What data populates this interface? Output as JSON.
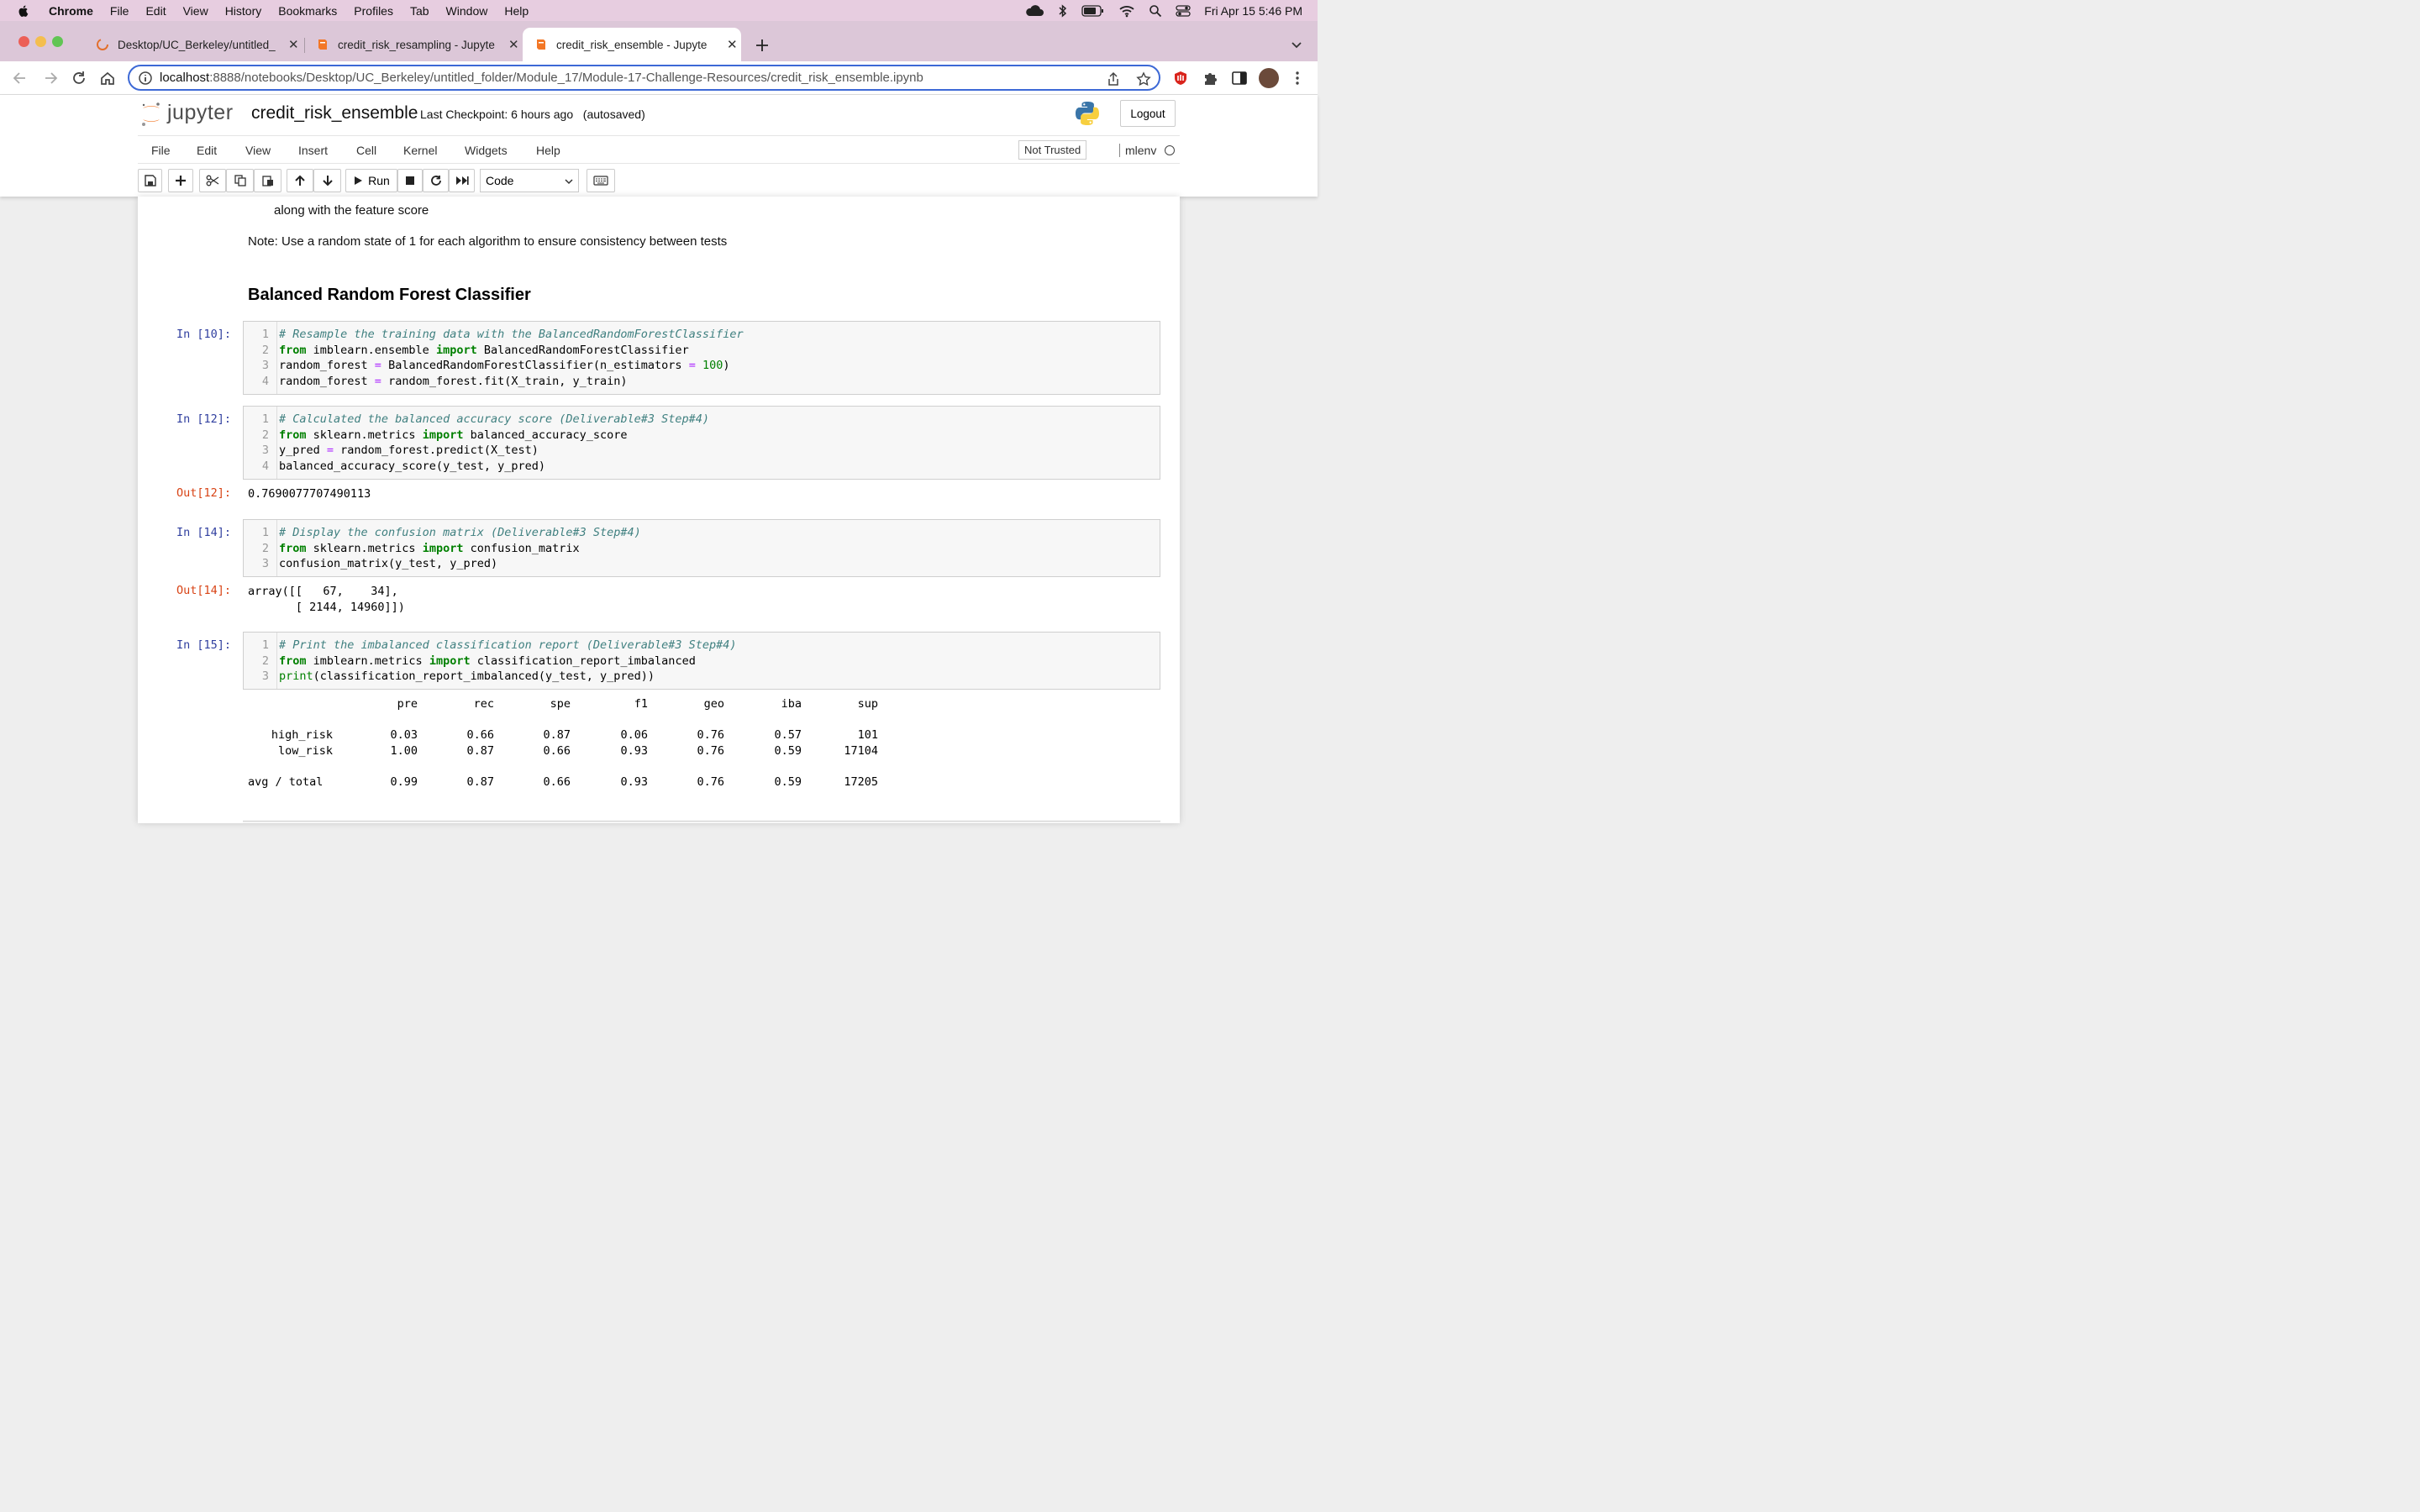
{
  "mac_menubar": {
    "app": "Chrome",
    "items": [
      "File",
      "Edit",
      "View",
      "History",
      "Bookmarks",
      "Profiles",
      "Tab",
      "Window",
      "Help"
    ],
    "datetime": "Fri Apr 15  5:46 PM"
  },
  "browser": {
    "tabs": [
      {
        "title": "Desktop/UC_Berkeley/untitled_",
        "active": false
      },
      {
        "title": "credit_risk_resampling - Jupyte",
        "active": false
      },
      {
        "title": "credit_risk_ensemble - Jupyte",
        "active": true
      }
    ],
    "url_host": "localhost",
    "url_path": ":8888/notebooks/Desktop/UC_Berkeley/untitled_folder/Module_17/Module-17-Challenge-Resources/credit_risk_ensemble.ipynb"
  },
  "jupyter": {
    "logo_text": "jupyter",
    "notebook_name": "credit_risk_ensemble",
    "checkpoint": "Last Checkpoint: 6 hours ago",
    "autosave": "(autosaved)",
    "logout": "Logout",
    "menu": [
      "File",
      "Edit",
      "View",
      "Insert",
      "Cell",
      "Kernel",
      "Widgets",
      "Help"
    ],
    "trusted": "Not Trusted",
    "kernel": "mlenv",
    "run_label": "Run",
    "cell_type": "Code"
  },
  "notebook": {
    "partial_line": "along with the feature score",
    "note": "Note: Use a random state of 1 for each algorithm to ensure consistency between tests",
    "heading": "Balanced Random Forest Classifier",
    "cells": [
      {
        "prompt": "In [10]:",
        "lines": [
          "# Resample the training data with the BalancedRandomForestClassifier",
          "from imblearn.ensemble import BalancedRandomForestClassifier",
          "random_forest = BalancedRandomForestClassifier(n_estimators = 100)",
          "random_forest = random_forest.fit(X_train, y_train)"
        ]
      },
      {
        "prompt": "In [12]:",
        "lines": [
          "# Calculated the balanced accuracy score (Deliverable#3 Step#4)",
          "from sklearn.metrics import balanced_accuracy_score",
          "y_pred = random_forest.predict(X_test)",
          "balanced_accuracy_score(y_test, y_pred)"
        ],
        "out_prompt": "Out[12]:",
        "output": "0.7690077707490113"
      },
      {
        "prompt": "In [14]:",
        "lines": [
          "# Display the confusion matrix (Deliverable#3 Step#4)",
          "from sklearn.metrics import confusion_matrix",
          "confusion_matrix(y_test, y_pred)"
        ],
        "out_prompt": "Out[14]:",
        "output_line1": "array([[   67,    34],",
        "output_line2": "       [ 2144, 14960]])"
      },
      {
        "prompt": "In [15]:",
        "lines": [
          "# Print the imbalanced classification report (Deliverable#3 Step#4)",
          "from imblearn.metrics import classification_report_imbalanced",
          "print(classification_report_imbalanced(y_test, y_pred))"
        ]
      }
    ],
    "report": {
      "headers": [
        "pre",
        "rec",
        "spe",
        "f1",
        "geo",
        "iba",
        "sup"
      ],
      "rows": [
        {
          "label": "high_risk",
          "values": [
            "0.03",
            "0.66",
            "0.87",
            "0.06",
            "0.76",
            "0.57",
            "101"
          ]
        },
        {
          "label": "low_risk",
          "values": [
            "1.00",
            "0.87",
            "0.66",
            "0.93",
            "0.76",
            "0.59",
            "17104"
          ]
        },
        {
          "label": "avg / total",
          "values": [
            "0.99",
            "0.87",
            "0.66",
            "0.93",
            "0.76",
            "0.59",
            "17205"
          ]
        }
      ]
    }
  }
}
